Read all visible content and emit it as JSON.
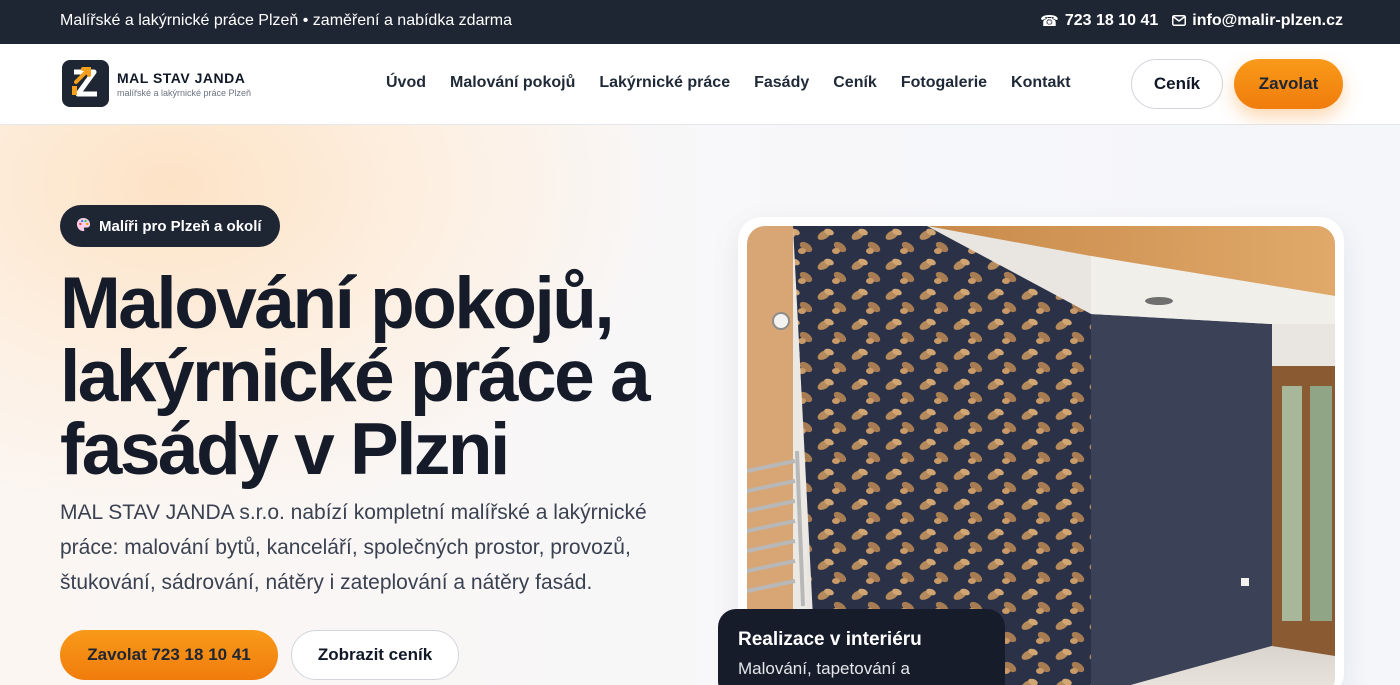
{
  "topbar": {
    "tagline": "Malířské a lakýrnické práce Plzeň • zaměření a nabídka zdarma",
    "phone": "723 18 10 41",
    "email": "info@malir-plzen.cz",
    "phone_icon": "phone-icon",
    "email_icon": "mail-icon"
  },
  "header": {
    "logo_brand": "MAL STAV JANDA",
    "logo_sub": "malířské a lakýrnické práce Plzeň",
    "nav": [
      "Úvod",
      "Malování pokojů",
      "Lakýrnické práce",
      "Fasády",
      "Ceník",
      "Fotogalerie",
      "Kontakt"
    ],
    "btn_pricing": "Ceník",
    "btn_call": "Zavolat"
  },
  "hero": {
    "badge": "Malíři pro Plzeň a okolí",
    "badge_icon": "palette-icon",
    "headline": "Malování pokojů, lakýrnické práce a fasády v Plzni",
    "lead": "MAL STAV JANDA s.r.o. nabízí kompletní malířské a lakýrnické práce: malování bytů, kanceláří, společných prostor, provozů, štukování, sádrování, nátěry i zateplování a nátěry fasád.",
    "cta_primary": "Zavolat 723 18 10 41",
    "cta_secondary": "Zobrazit ceník",
    "caption_title": "Realizace v interiéru",
    "caption_text": "Malování, tapetování a"
  },
  "colors": {
    "dark": "#1f2633",
    "accent": "#f58a12"
  }
}
